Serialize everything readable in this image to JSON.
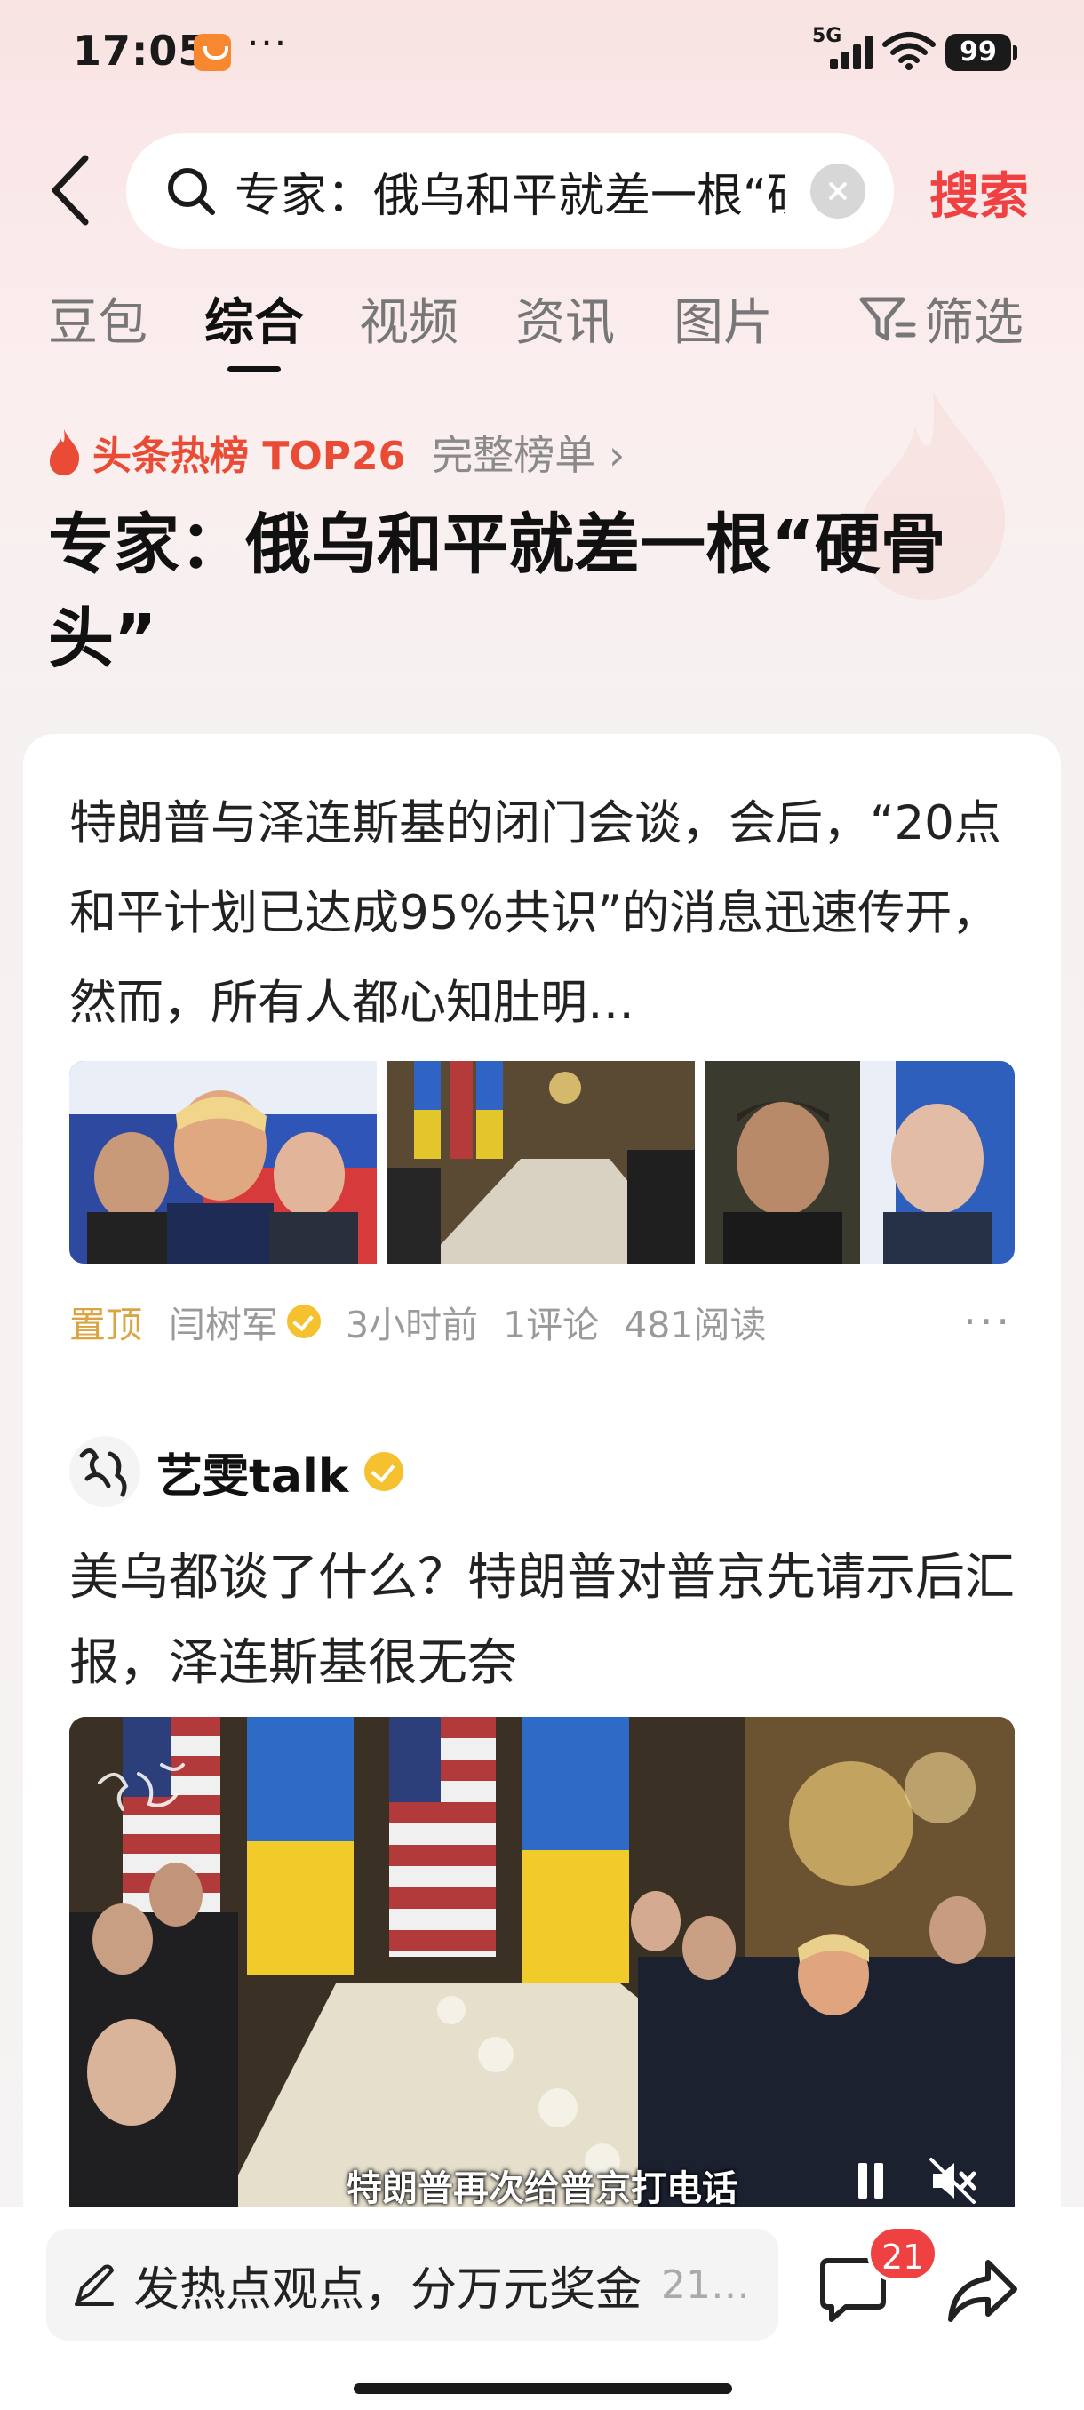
{
  "status_bar": {
    "time": "17:05",
    "more": "···",
    "network": "5G",
    "battery": "99"
  },
  "search": {
    "query": "专家：俄乌和平就差一根“硬骨头”",
    "button_label": "搜索"
  },
  "tabs": [
    {
      "label": "豆包",
      "active": false
    },
    {
      "label": "综合",
      "active": true
    },
    {
      "label": "视频",
      "active": false
    },
    {
      "label": "资讯",
      "active": false
    },
    {
      "label": "图片",
      "active": false
    }
  ],
  "filter_label": "筛选",
  "hot_topic": {
    "label": "头条热榜 TOP26",
    "full_list": "完整榜单 ›",
    "headline": "专家：俄乌和平就差一根“硬骨头”"
  },
  "article1": {
    "text": "特朗普与泽连斯基的闭门会谈，会后，“20点和平计划已达成95%共识”的消息迅速传开，然而，所有人都心知肚明…",
    "pinned": "置顶",
    "author": "闫树军",
    "time": "3小时前",
    "comments": "1评论",
    "reads": "481阅读",
    "more": "···"
  },
  "article2": {
    "account": "艺雯talk",
    "title": "美乌都谈了什么？特朗普对普京先请示后汇报，泽连斯基很无奈",
    "video_caption": "特朗普再次给普京打电话"
  },
  "bottom_bar": {
    "comment_placeholder": "发热点观点，分万元奖金",
    "comment_count": "21…",
    "message_badge": "21"
  },
  "colors": {
    "accent_red": "#f04142",
    "hot_orange": "#ea4b35",
    "pinned_gold": "#d9a441",
    "verified_yellow": "#f5c12f"
  }
}
